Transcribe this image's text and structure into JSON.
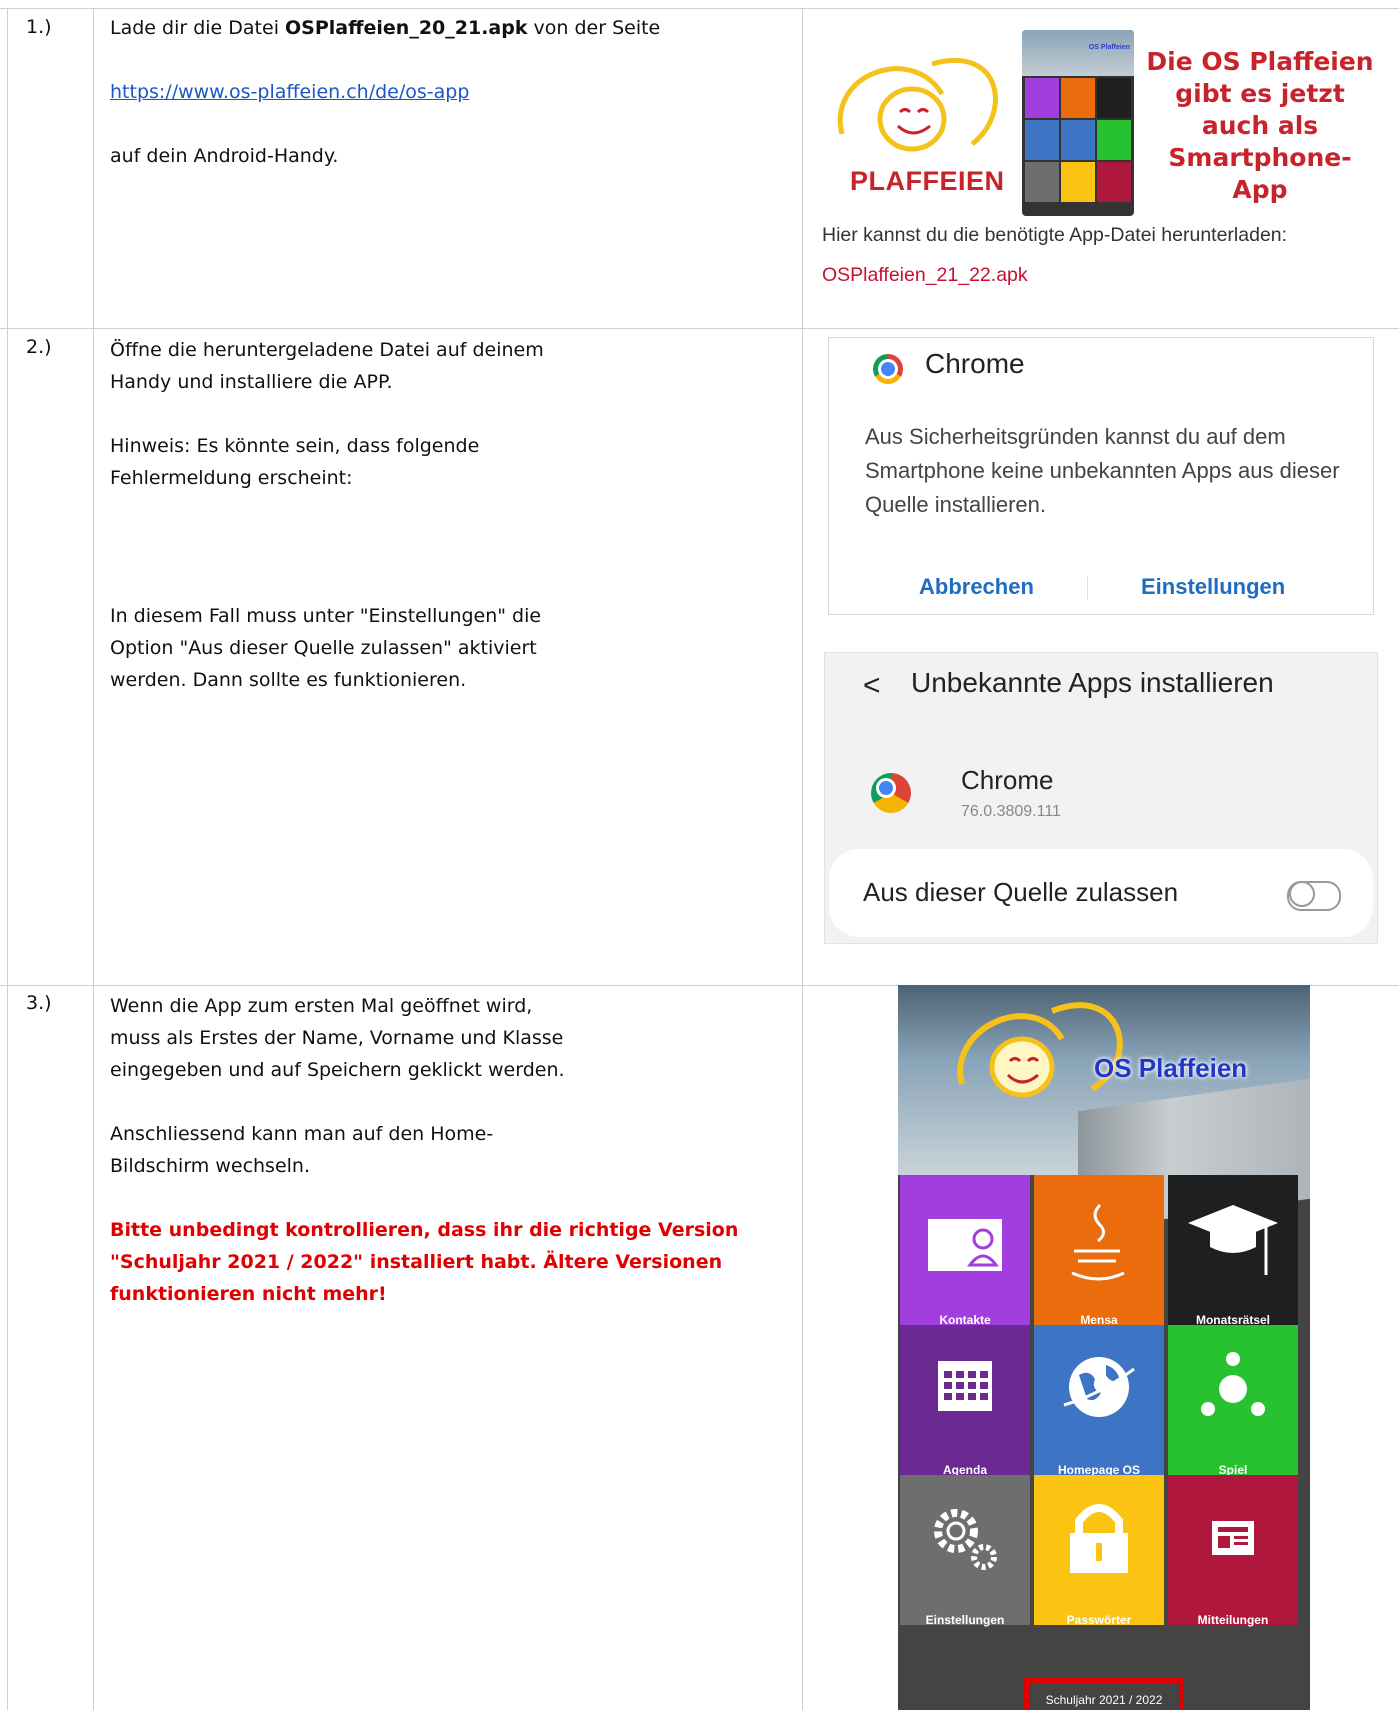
{
  "rows": [
    {
      "number": "1.)",
      "line1_prefix": "Lade dir die Datei ",
      "line1_filename": "OSPlaffeien_20_21.apk",
      "line1_suffix": " von der Seite",
      "link": "https://www.os-plaffeien.ch/de/os-app",
      "line3": "auf dein Android-Handy.",
      "banner": {
        "brand": "PLAFFEIEN",
        "slogan": [
          "Die OS Plaffeien",
          "gibt es jetzt",
          "auch als",
          "Smartphone-App"
        ],
        "mini_title": "OS Plaffeien",
        "download_text": "Hier kannst du die benötigte App-Datei herunterladen:",
        "download_file": "OSPlaffeien_21_22.apk"
      }
    },
    {
      "number": "2.)",
      "para1": [
        "Öffne die heruntergeladene Datei auf deinem",
        "Handy und installiere die APP."
      ],
      "para2": [
        "Hinweis: Es könnte sein, dass folgende",
        "Fehlermeldung erscheint:"
      ],
      "para3": [
        "In diesem Fall muss unter \"Einstellungen\" die",
        "Option \"Aus dieser Quelle zulassen\" aktiviert",
        "werden. Dann sollte es funktionieren."
      ],
      "dialog": {
        "title": "Chrome",
        "message": "Aus Sicherheitsgründen kannst du auf dem Smartphone keine unbekannten Apps aus dieser Quelle installieren.",
        "cancel": "Abbrechen",
        "settings": "Einstellungen"
      },
      "settings_screen": {
        "back": "<",
        "title": "Unbekannte Apps installieren",
        "app_name": "Chrome",
        "app_version": "76.0.3809.111",
        "toggle_label": "Aus dieser Quelle zulassen"
      }
    },
    {
      "number": "3.)",
      "para1": [
        "Wenn die App zum ersten Mal geöffnet wird,",
        "muss als Erstes der Name, Vorname und Klasse",
        "eingegeben und auf Speichern geklickt werden."
      ],
      "para2": [
        "Anschliessend kann man auf den Home-",
        "Bildschirm wechseln."
      ],
      "warning": [
        "Bitte unbedingt kontrollieren, dass ihr die richtige Version",
        "\"Schuljahr 2021 / 2022\" installiert habt. Ältere Versionen",
        "funktionieren nicht mehr!"
      ],
      "phone": {
        "title": "OS Plaffeien",
        "tiles": [
          {
            "label": "Kontakte",
            "color": "#a23ee0",
            "icon": "contact-card-icon"
          },
          {
            "label": "Mensa",
            "color": "#ea6c0c",
            "icon": "java-cup-icon"
          },
          {
            "label": "Monatsrätsel",
            "color": "#1f1f1f",
            "icon": "graduation-cap-icon"
          },
          {
            "label": "Agenda",
            "color": "#6a2a92",
            "icon": "calendar-icon"
          },
          {
            "label": "Homepage OS",
            "color": "#3d74c4",
            "icon": "globe-icon"
          },
          {
            "label": "Spiel",
            "color": "#28c12f",
            "icon": "network-icon"
          },
          {
            "label": "Einstellungen",
            "color": "#6e6e6e",
            "icon": "gears-icon"
          },
          {
            "label": "Passwörter",
            "color": "#fcc412",
            "icon": "lock-icon"
          },
          {
            "label": "Mitteilungen",
            "color": "#b0173c",
            "icon": "news-icon"
          }
        ],
        "version": "Schuljahr 2021 / 2022"
      }
    }
  ]
}
